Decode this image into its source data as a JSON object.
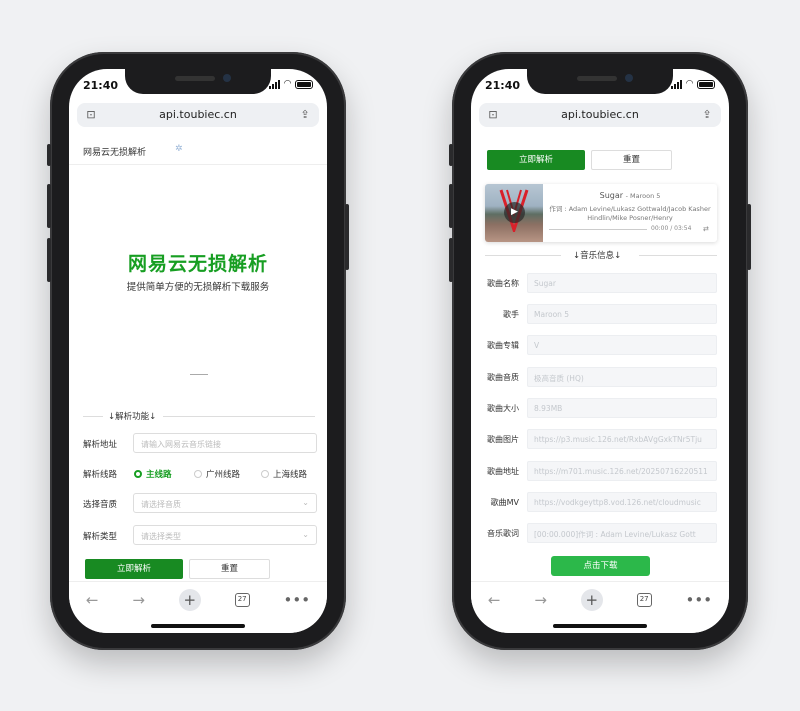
{
  "status": {
    "time": "21:40"
  },
  "browser": {
    "url": "api.toubiec.cn",
    "tabs_count": "27"
  },
  "left": {
    "header_title": "网易云无损解析",
    "hero_title": "网易云无损解析",
    "hero_subtitle": "提供简单方便的无损解析下载服务",
    "section_label": "↓解析功能↓",
    "address_label": "解析地址",
    "address_placeholder": "请输入网易云音乐链接",
    "route_label": "解析线路",
    "routes": [
      "主线路",
      "广州线路",
      "上海线路"
    ],
    "selected_route": "主线路",
    "quality_label": "选择音质",
    "quality_placeholder": "请选择音质",
    "type_label": "解析类型",
    "type_placeholder": "请选择类型",
    "parse_button": "立即解析",
    "reset_button": "重置"
  },
  "right": {
    "parse_button": "立即解析",
    "reset_button": "重置",
    "player": {
      "song": "Sugar",
      "artist_suffix": "- Maroon 5",
      "lyric": "作词 : Adam Levine/Lukasz Gottwald/Jacob Kasher Hindlin/Mike Posner/Henry",
      "time": "00:00 / 03:54"
    },
    "section_label": "↓音乐信息↓",
    "fields": [
      {
        "label": "歌曲名称",
        "value": "Sugar"
      },
      {
        "label": "歌手",
        "value": "Maroon 5"
      },
      {
        "label": "歌曲专辑",
        "value": "V"
      },
      {
        "label": "歌曲音质",
        "value": "极高音质 (HQ)"
      },
      {
        "label": "歌曲大小",
        "value": "8.93MB"
      },
      {
        "label": "歌曲图片",
        "value": "https://p3.music.126.net/RxbAVgGxkTNr5Tju"
      },
      {
        "label": "歌曲地址",
        "value": "https://m701.music.126.net/20250716220511"
      },
      {
        "label": "歌曲MV",
        "value": "https://vodkgeyttp8.vod.126.net/cloudmusic"
      },
      {
        "label": "音乐歌词",
        "value": "[00:00.000]作词 : Adam Levine/Lukasz Gott"
      }
    ],
    "download_button": "点击下载"
  },
  "colors": {
    "accent_green": "#188a22",
    "title_green": "#179e22",
    "download_green": "#2cb84a"
  }
}
